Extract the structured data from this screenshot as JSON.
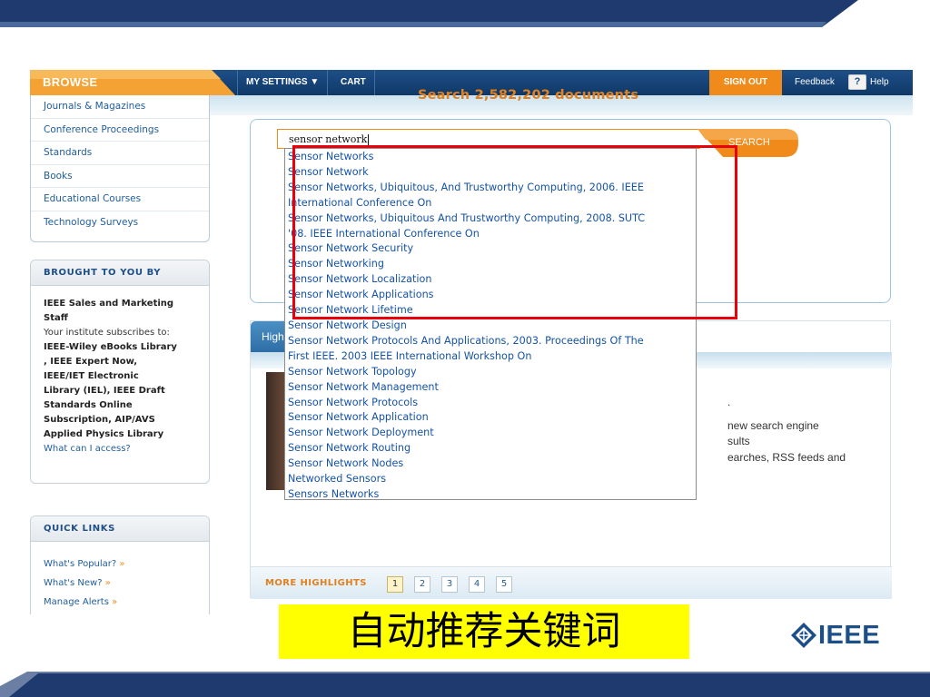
{
  "colors": {
    "brand_navy": "#0f3867",
    "accent_orange": "#f08b1b",
    "link_blue": "#1553a5",
    "annotation_red": "#e8000b",
    "caption_yellow": "#ffff00"
  },
  "nav": {
    "browse": "BROWSE",
    "my_settings": "MY SETTINGS ▼",
    "cart": "CART",
    "sign_out": "SIGN OUT",
    "feedback": "Feedback",
    "help_icon": "?",
    "help": "Help"
  },
  "browse_menu": {
    "items": [
      {
        "label": "Journals & Magazines"
      },
      {
        "label": "Conference Proceedings"
      },
      {
        "label": "Standards"
      },
      {
        "label": "Books"
      },
      {
        "label": "Educational Courses"
      },
      {
        "label": "Technology Surveys"
      }
    ]
  },
  "brought": {
    "title": "BROUGHT TO YOU BY",
    "org": "IEEE Sales and Marketing Staff",
    "subscribes": "Your institute subscribes to:",
    "products": [
      "IEEE-Wiley eBooks Library",
      ", IEEE Expert Now,",
      "IEEE/IET Electronic",
      "Library (IEL), IEEE Draft",
      "Standards Online",
      "Subscription, AIP/AVS",
      "Applied Physics Library"
    ],
    "access_link": "What can I access?"
  },
  "quick_links": {
    "title": "QUICK LINKS",
    "items": [
      {
        "label": "What's Popular?"
      },
      {
        "label": "What's New?"
      },
      {
        "label": "Manage Alerts"
      }
    ],
    "arrow": "»"
  },
  "search": {
    "title": "Search 2,582,202 documents",
    "query": "sensor network",
    "button": "SEARCH"
  },
  "suggestions": [
    "Sensor Networks",
    "Sensor Network",
    "Sensor Networks, Ubiquitous, And Trustworthy Computing, 2006. IEEE",
    "International Conference On",
    "Sensor Networks, Ubiquitous And Trustworthy Computing, 2008. SUTC",
    "'08. IEEE International Conference On",
    "Sensor Network Security",
    "Sensor Networking",
    "Sensor Network Localization",
    "Sensor Network Applications",
    "Sensor Network Lifetime",
    "Sensor Network Design",
    "Sensor Network Protocols And Applications, 2003. Proceedings Of The",
    "First IEEE. 2003 IEEE International Workshop On",
    "Sensor Network Topology",
    "Sensor Network Management",
    "Sensor Network Protocols",
    "Sensor Network Application",
    "Sensor Network Deployment",
    "Sensor Network Routing",
    "Sensor Network Nodes",
    "Networked Sensors",
    "Sensors Networks"
  ],
  "highlights": {
    "tab": "Highlights",
    "fragments": [
      ".",
      "new search engine",
      "sults",
      "earches, RSS feeds and"
    ],
    "more": "MORE HIGHLIGHTS",
    "pages": [
      "1",
      "2",
      "3",
      "4",
      "5"
    ],
    "active_page": "1"
  },
  "caption": "自动推荐关键词",
  "logo": "IEEE"
}
